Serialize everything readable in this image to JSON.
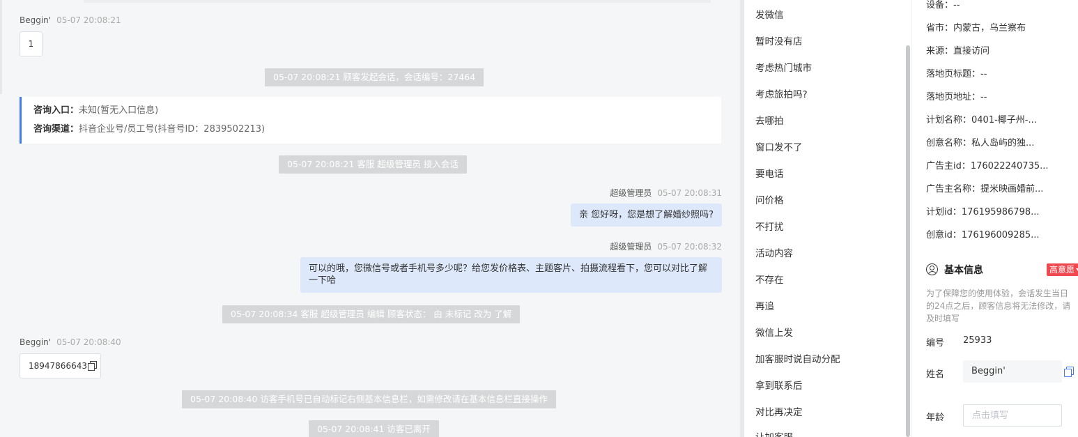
{
  "chat": {
    "msg1": {
      "name": "Beggin'",
      "time": "05-07 20:08:21",
      "text": "1"
    },
    "sys1": "05-07 20:08:21 顾客发起会话，会话编号：27464",
    "entry": {
      "label1": "咨询入口：",
      "value1": "未知(暂无入口信息)",
      "label2": "咨询渠道：",
      "value2": "抖音企业号/员工号(抖音号ID：2839502213)"
    },
    "sys2": "05-07 20:08:21 客服 超级管理员 接入会话",
    "msg2": {
      "name": "超级管理员",
      "time": "05-07 20:08:31",
      "text": "亲 您好呀，您是想了解婚纱照吗?"
    },
    "msg3": {
      "name": "超级管理员",
      "time": "05-07 20:08:32",
      "line1": "可以的哦，您微信号或者手机号多少呢？给您发价格表、主题客片、拍摄流程看下，您可以对比了解",
      "line2": "一下哈"
    },
    "sys3": "05-07 20:08:34 客服 超级管理员 编辑 顾客状态： 由 未标记 改为 了解",
    "msg4": {
      "name": "Beggin'",
      "time": "05-07 20:08:40",
      "text": "18947866643"
    },
    "sys4": "05-07 20:08:40 访客手机号已自动标记右侧基本信息栏，如需修改请在基本信息栏直接操作",
    "sys5": "05-07 20:08:41 访客已离开"
  },
  "quick_replies": [
    "发微信",
    "暂时没有店",
    "考虑热门城市",
    "考虑旅拍吗?",
    "去哪拍",
    "窗口发不了",
    "要电话",
    "问价格",
    "不打扰",
    "活动内容",
    "不存在",
    "再追",
    "微信上发",
    "加客服时说自动分配",
    "拿到联系后",
    "对比再决定",
    "让加客服"
  ],
  "panel": {
    "device": "设备：--",
    "province": "省市：内蒙古，乌兰察布",
    "source": "来源：直接访问",
    "landing_title": "落地页标题：--",
    "landing_url": "落地页地址：--",
    "plan_name": "计划名称：0401-椰子州-...",
    "creative_name": "创意名称：私人岛屿的独...",
    "advertiser_id": "广告主id：176022240735...",
    "advertiser_name": "广告主名称：提米映画婚前...",
    "plan_id": "计划id：176195986798...",
    "creative_id": "创意id：176196009285...",
    "basic_info_title": "基本信息",
    "intent_tag": "高意愿",
    "notice": "为了保障您的使用体验，会话发生当日的24点之后，顾客信息将无法修改，请及时填写",
    "id_label": "编号",
    "id_value": "25933",
    "name_label": "姓名",
    "name_value": "Beggin'",
    "age_label": "年龄",
    "age_placeholder": "点击填写"
  }
}
